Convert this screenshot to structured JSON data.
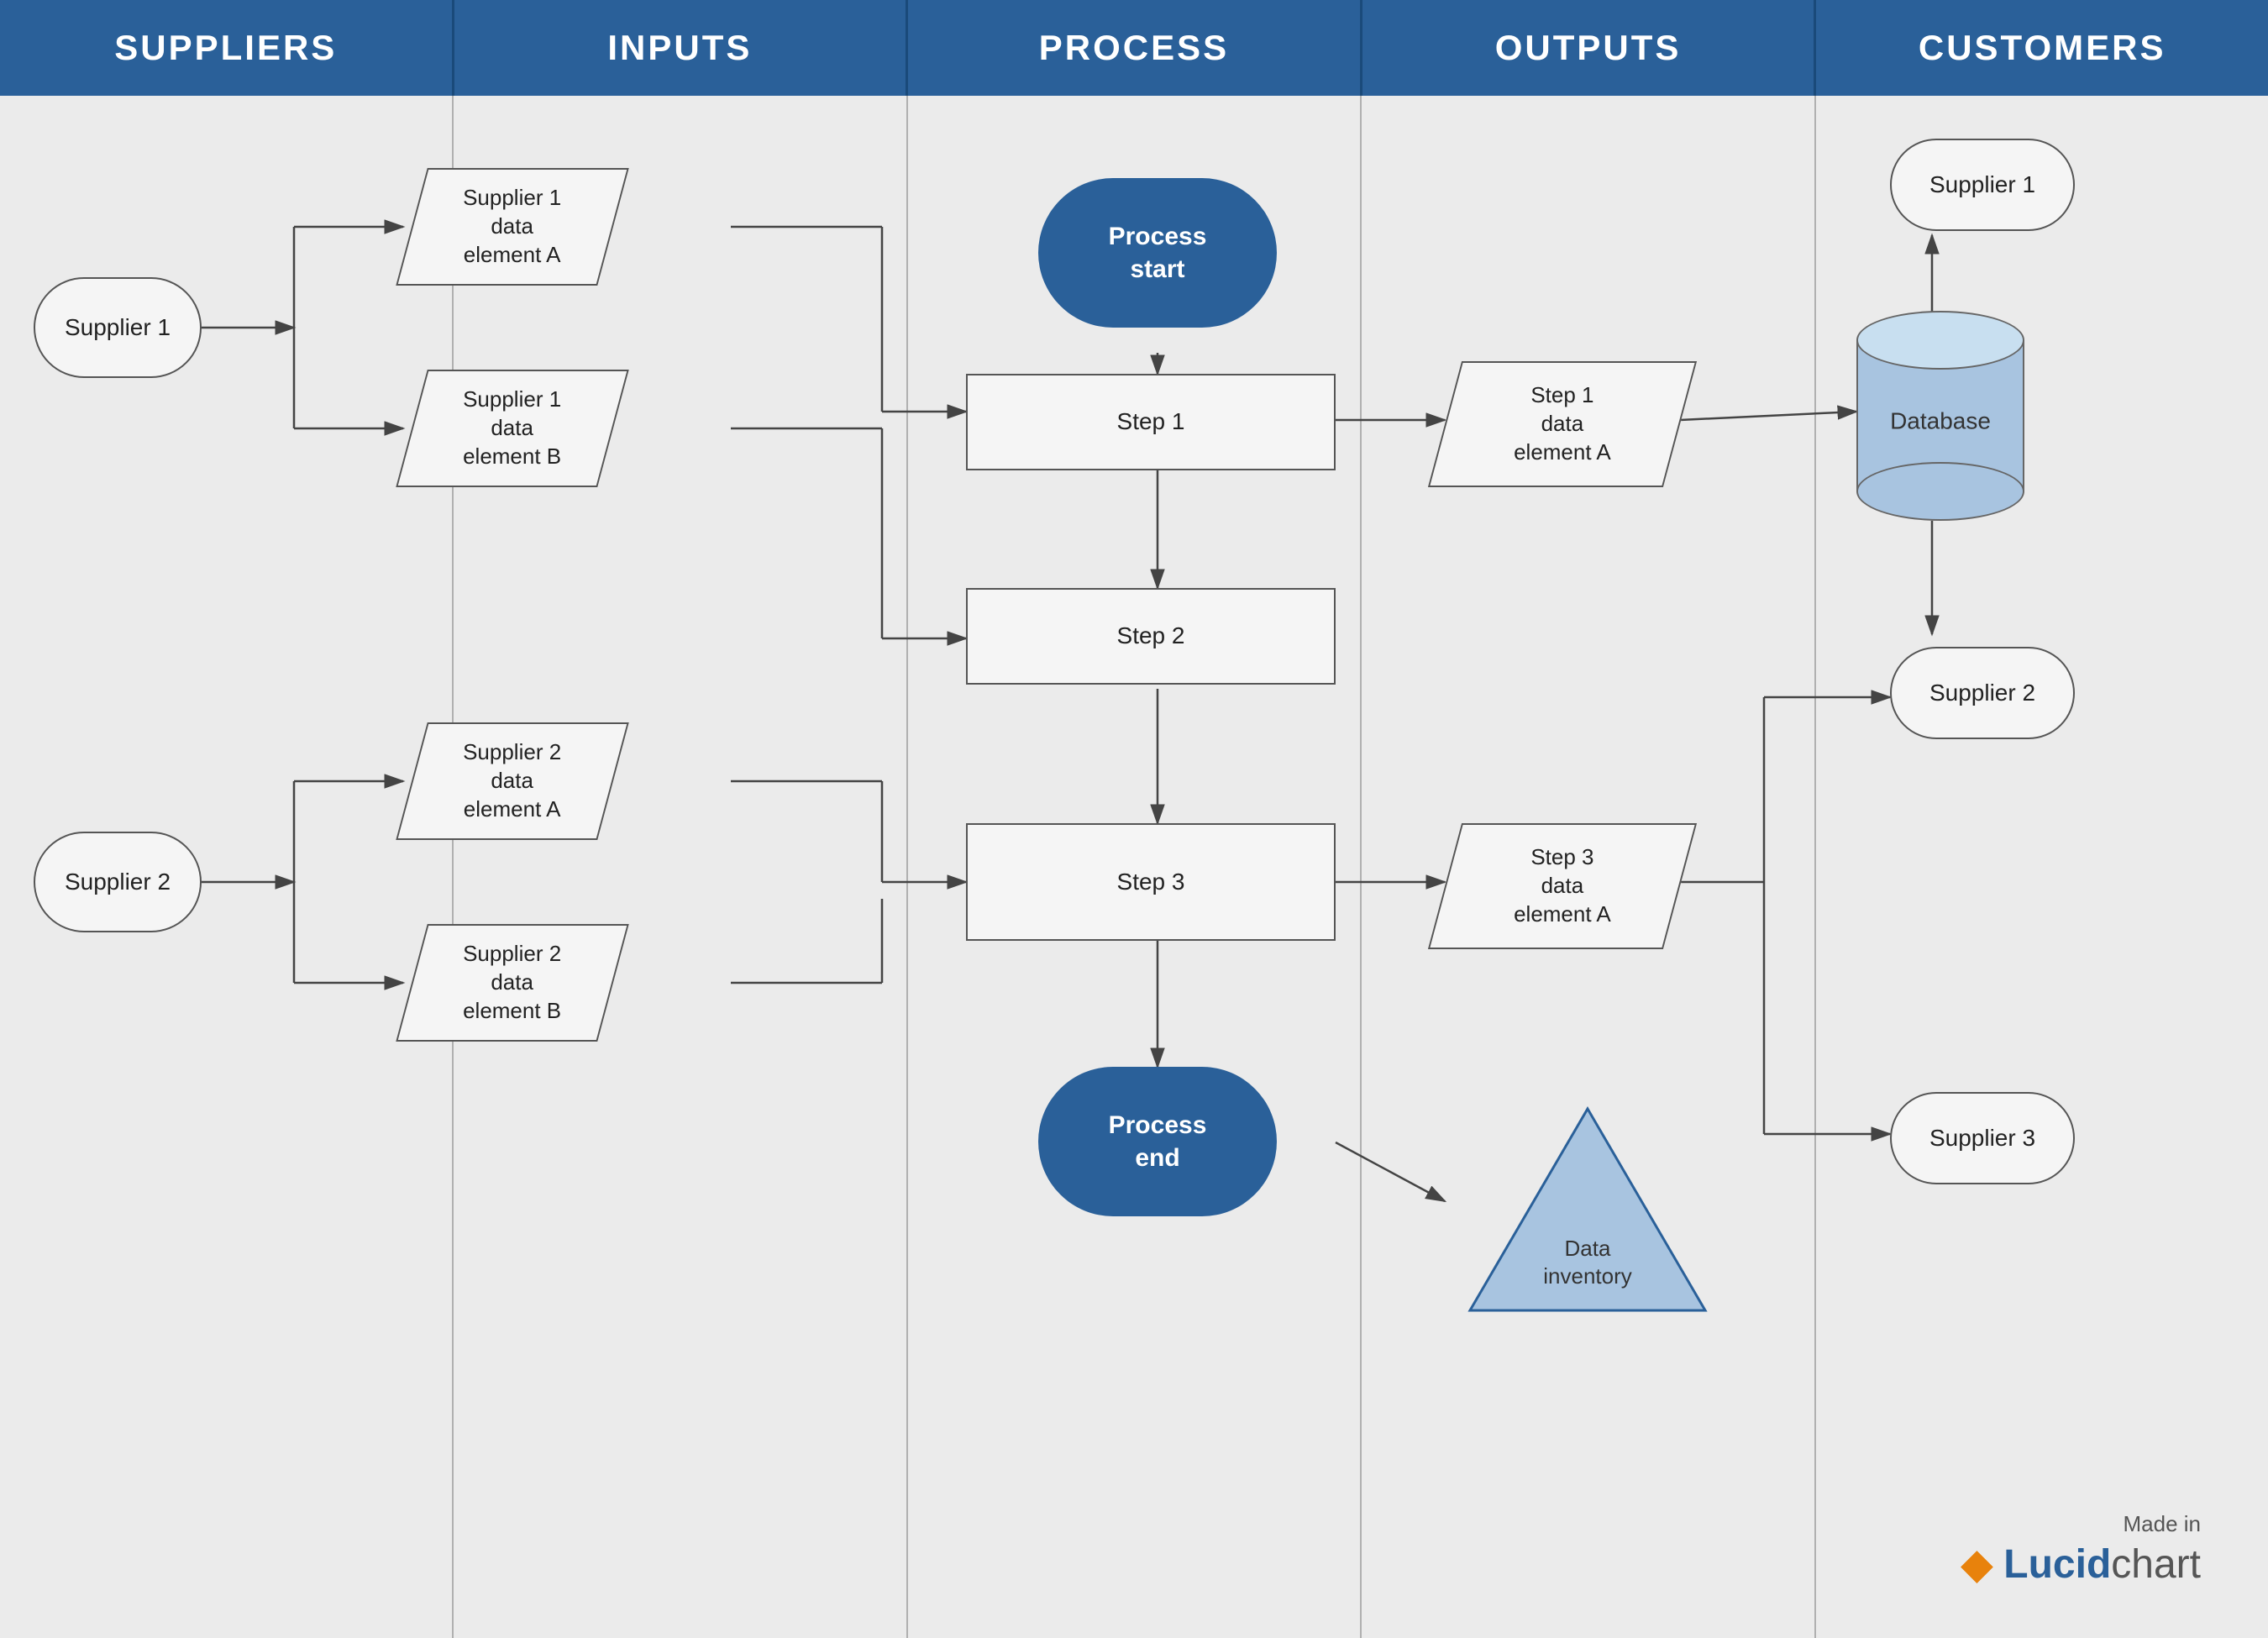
{
  "headers": [
    {
      "id": "suppliers",
      "label": "SUPPLIERS"
    },
    {
      "id": "inputs",
      "label": "INPUTS"
    },
    {
      "id": "process",
      "label": "PROCESS"
    },
    {
      "id": "outputs",
      "label": "OUTPUTS"
    },
    {
      "id": "customers",
      "label": "CUSTOMERS"
    }
  ],
  "shapes": {
    "supplier1": {
      "label": "Supplier 1"
    },
    "supplier2": {
      "label": "Supplier 2"
    },
    "input1a": {
      "label": "Supplier 1\ndata\nelement A"
    },
    "input1b": {
      "label": "Supplier 1\ndata\nelement B"
    },
    "input2a": {
      "label": "Supplier 2\ndata\nelement A"
    },
    "input2b": {
      "label": "Supplier 2\ndata\nelement B"
    },
    "process_start": {
      "label": "Process\nstart"
    },
    "step1": {
      "label": "Step 1"
    },
    "step2": {
      "label": "Step 2"
    },
    "step3": {
      "label": "Step 3"
    },
    "process_end": {
      "label": "Process\nend"
    },
    "output1a": {
      "label": "Step 1\ndata\nelement A"
    },
    "output3a": {
      "label": "Step 3\ndata\nelement A"
    },
    "data_inventory": {
      "label": "Data\ninventory"
    },
    "database": {
      "label": "Database"
    },
    "cust_supplier1": {
      "label": "Supplier 1"
    },
    "cust_supplier2": {
      "label": "Supplier 2"
    },
    "cust_supplier3": {
      "label": "Supplier 3"
    }
  },
  "branding": {
    "made_in": "Made in",
    "lucid": "Lucid",
    "chart": "chart"
  }
}
